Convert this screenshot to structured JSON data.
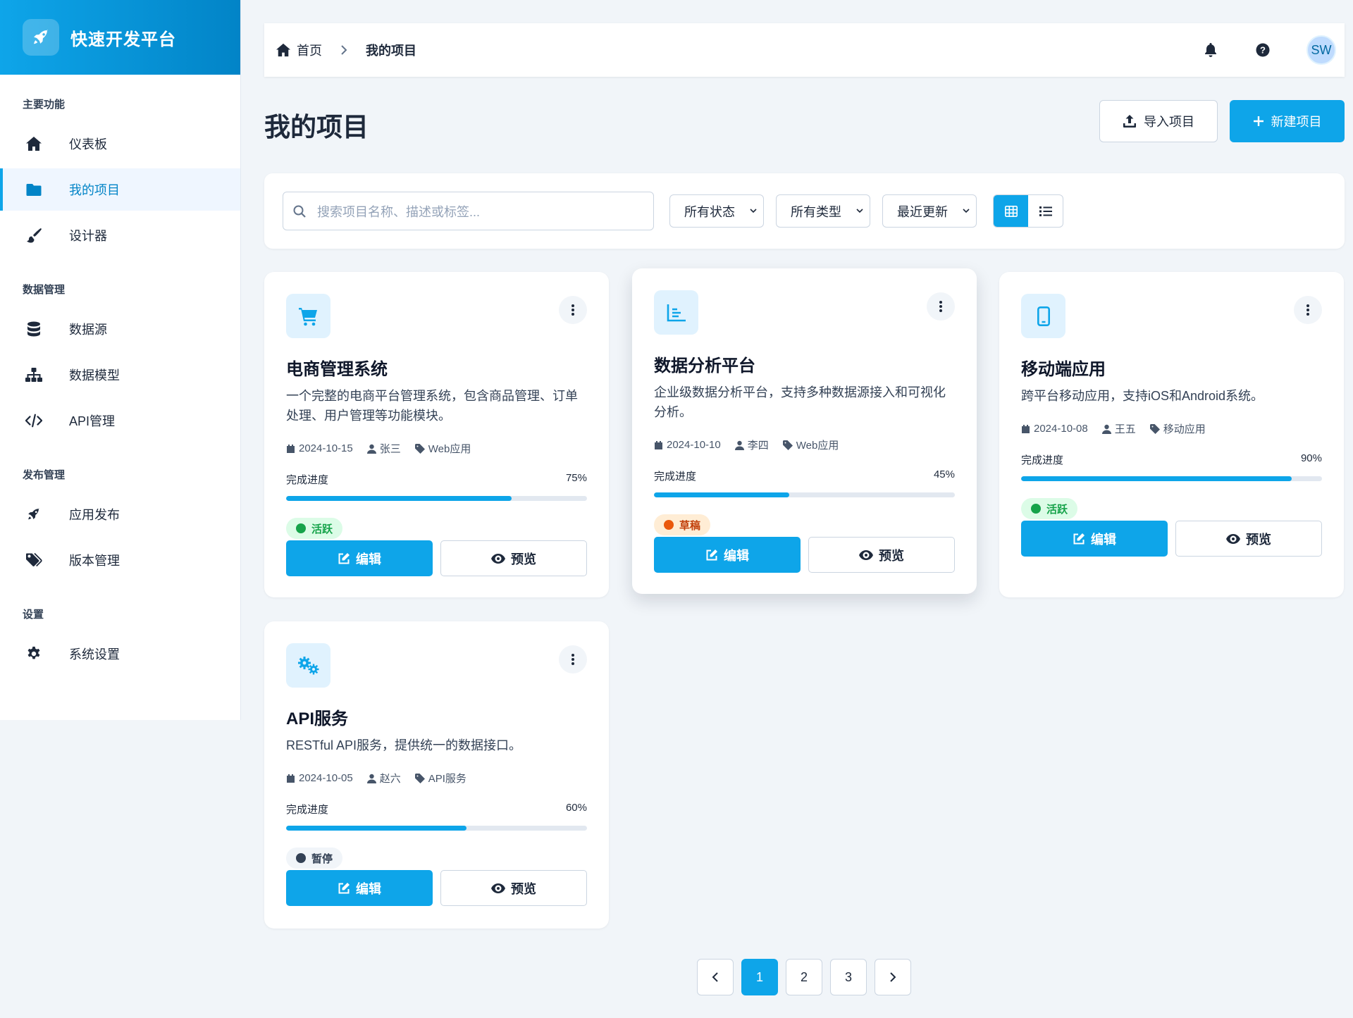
{
  "brand": {
    "title": "快速开发平台"
  },
  "sidebar": {
    "sections": [
      {
        "heading": "主要功能",
        "items": [
          {
            "label": "仪表板",
            "icon": "home-icon"
          },
          {
            "label": "我的项目",
            "icon": "folder-icon",
            "active": true
          },
          {
            "label": "设计器",
            "icon": "brush-icon"
          }
        ]
      },
      {
        "heading": "数据管理",
        "items": [
          {
            "label": "数据源",
            "icon": "database-icon"
          },
          {
            "label": "数据模型",
            "icon": "sitemap-icon"
          },
          {
            "label": "API管理",
            "icon": "code-icon"
          }
        ]
      },
      {
        "heading": "发布管理",
        "items": [
          {
            "label": "应用发布",
            "icon": "rocket-icon"
          },
          {
            "label": "版本管理",
            "icon": "tags-icon"
          }
        ]
      },
      {
        "heading": "设置",
        "items": [
          {
            "label": "系统设置",
            "icon": "gear-icon"
          }
        ]
      }
    ]
  },
  "breadcrumb": {
    "home": "首页",
    "current": "我的项目"
  },
  "user": {
    "initials": "SW"
  },
  "page": {
    "title": "我的项目",
    "import_label": "导入项目",
    "new_label": "新建项目"
  },
  "filters": {
    "search_placeholder": "搜索项目名称、描述或标签...",
    "status": "所有状态",
    "type": "所有类型",
    "sort": "最近更新"
  },
  "projects": [
    {
      "title": "电商管理系统",
      "description": "一个完整的电商平台管理系统，包含商品管理、订单处理、用户管理等功能模块。",
      "date": "2024-10-15",
      "owner": "张三",
      "type": "Web应用",
      "progress_label": "完成进度",
      "progress": 75,
      "progress_text": "75%",
      "status": "活跃",
      "icon": "cart-icon",
      "edit_label": "编辑",
      "preview_label": "预览"
    },
    {
      "title": "数据分析平台",
      "description": "企业级数据分析平台，支持多种数据源接入和可视化分析。",
      "date": "2024-10-10",
      "owner": "李四",
      "type": "Web应用",
      "progress_label": "完成进度",
      "progress": 45,
      "progress_text": "45%",
      "status": "草稿",
      "icon": "chart-icon",
      "edit_label": "编辑",
      "preview_label": "预览"
    },
    {
      "title": "移动端应用",
      "description": "跨平台移动应用，支持iOS和Android系统。",
      "date": "2024-10-08",
      "owner": "王五",
      "type": "移动应用",
      "progress_label": "完成进度",
      "progress": 90,
      "progress_text": "90%",
      "status": "活跃",
      "icon": "mobile-icon",
      "edit_label": "编辑",
      "preview_label": "预览"
    },
    {
      "title": "API服务",
      "description": "RESTful API服务，提供统一的数据接口。",
      "date": "2024-10-05",
      "owner": "赵六",
      "type": "API服务",
      "progress_label": "完成进度",
      "progress": 60,
      "progress_text": "60%",
      "status": "暂停",
      "icon": "cogs-icon",
      "edit_label": "编辑",
      "preview_label": "预览"
    }
  ],
  "pagination": {
    "pages": [
      "1",
      "2",
      "3"
    ],
    "current": "1"
  },
  "colors": {
    "accent": "#0ea5e9",
    "active": "#16a34a",
    "draft": "#ea580c",
    "paused": "#334155"
  }
}
